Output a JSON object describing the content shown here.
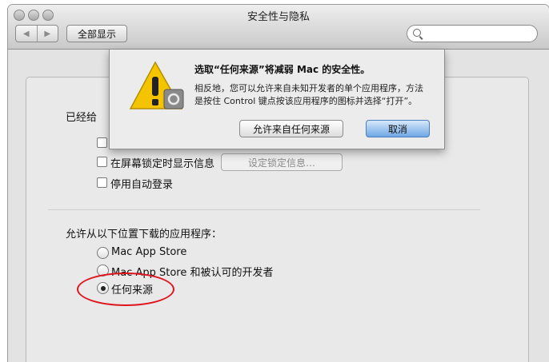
{
  "window": {
    "title": "安全性与隐私"
  },
  "toolbar": {
    "back_label": "◀",
    "forward_label": "▶",
    "show_all_label": "全部显示",
    "search_placeholder": ""
  },
  "general": {
    "section_label": "已经给",
    "lock_message_label": "在屏幕锁定时显示信息",
    "set_lock_message_label": "设定锁定信息…",
    "disable_autologin_label": "停用自动登录"
  },
  "download": {
    "heading": "允许从以下位置下载的应用程序：",
    "options": [
      {
        "label": "Mac App Store",
        "selected": false
      },
      {
        "label": "Mac App Store 和被认可的开发者",
        "selected": false
      },
      {
        "label": "任何来源",
        "selected": true
      }
    ]
  },
  "alert": {
    "title": "选取“任何来源”将减弱 Mac 的安全性。",
    "body_line1": "相反地，您可以允许来自未知开发者的单个应用程序，方法",
    "body_line2": "是按住 Control 键点按该应用程序的图标并选择“打开”。",
    "allow_button": "允许来自任何来源",
    "cancel_button": "取消"
  },
  "colors": {
    "highlight": "#e0141e",
    "default_button": "#6fa6e4",
    "warning": "#f5c400"
  }
}
